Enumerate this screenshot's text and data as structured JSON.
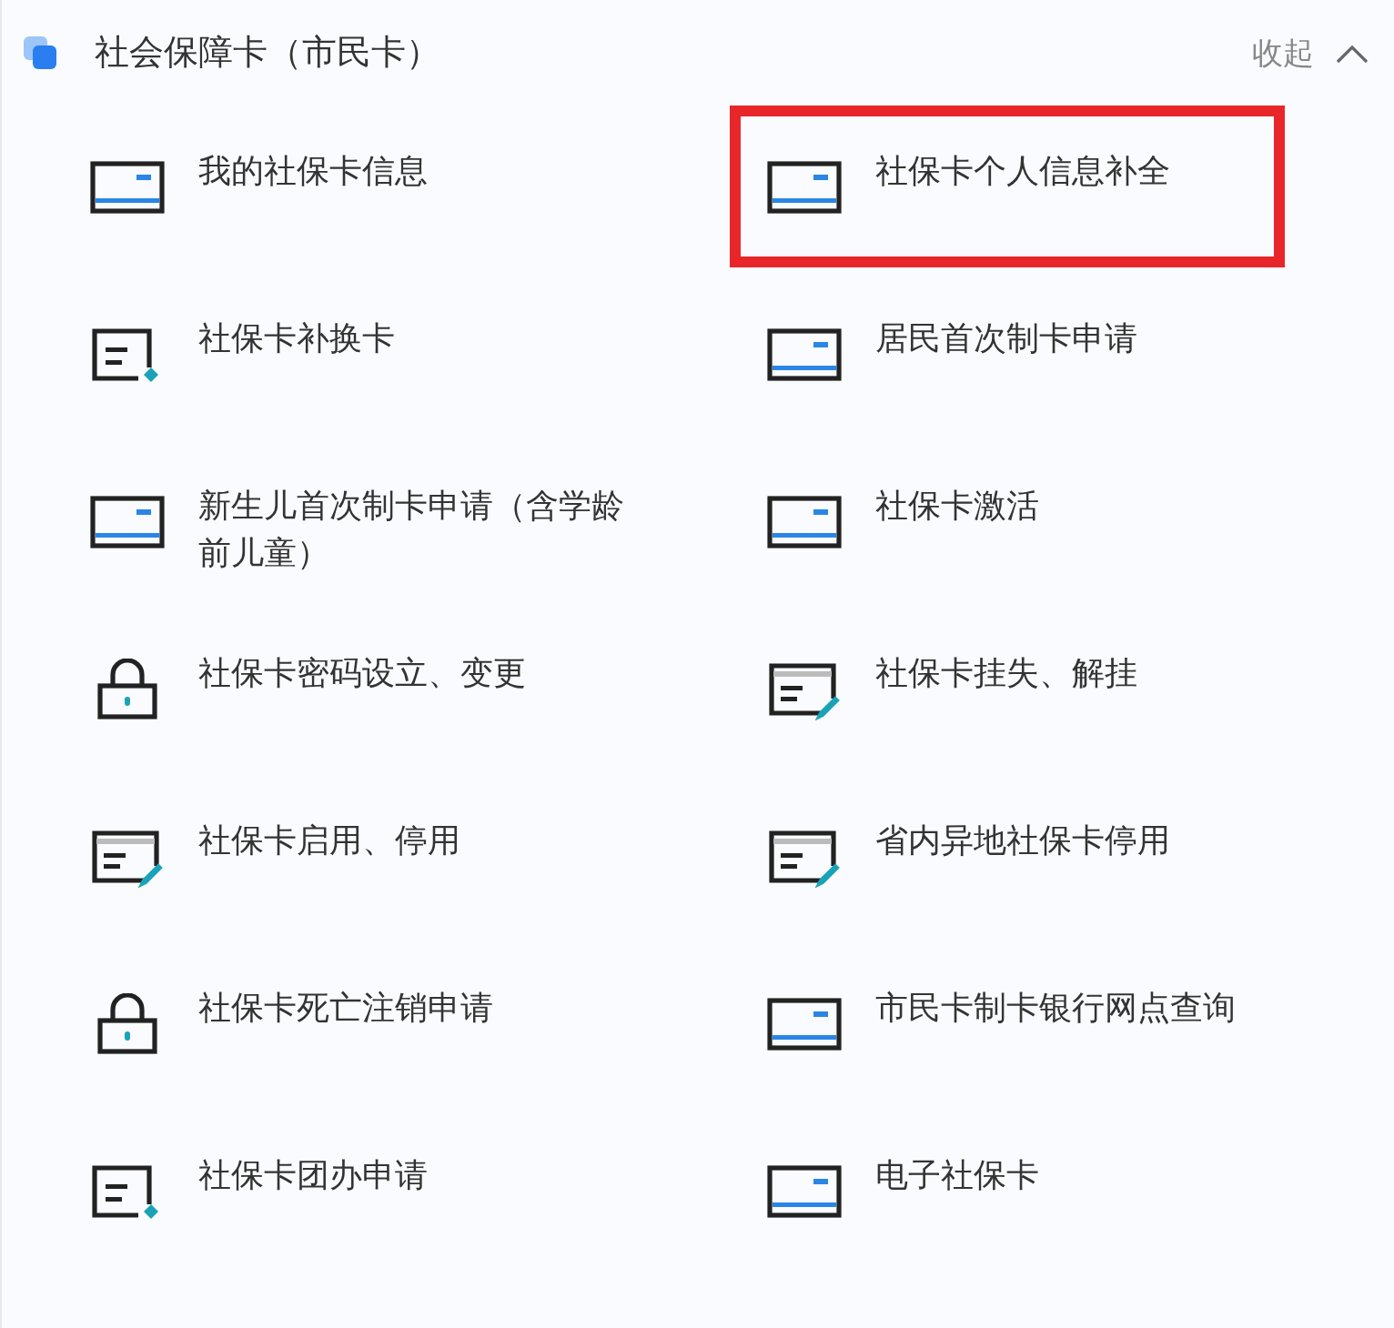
{
  "header": {
    "title": "社会保障卡（市民卡）",
    "collapse_label": "收起",
    "expanded": true
  },
  "items": [
    {
      "label": "我的社保卡信息",
      "kind": "card",
      "highlighted": false
    },
    {
      "label": "社保卡个人信息补全",
      "kind": "card",
      "highlighted": true
    },
    {
      "label": "社保卡补换卡",
      "kind": "form",
      "highlighted": false
    },
    {
      "label": "居民首次制卡申请",
      "kind": "card",
      "highlighted": false
    },
    {
      "label": "新生儿首次制卡申请（含学龄前儿童）",
      "kind": "card",
      "highlighted": false
    },
    {
      "label": "社保卡激活",
      "kind": "card",
      "highlighted": false
    },
    {
      "label": "社保卡密码设立、变更",
      "kind": "lock",
      "highlighted": false
    },
    {
      "label": "社保卡挂失、解挂",
      "kind": "edit",
      "highlighted": false
    },
    {
      "label": "社保卡启用、停用",
      "kind": "edit",
      "highlighted": false
    },
    {
      "label": "省内异地社保卡停用",
      "kind": "edit",
      "highlighted": false
    },
    {
      "label": "社保卡死亡注销申请",
      "kind": "lock",
      "highlighted": false
    },
    {
      "label": "市民卡制卡银行网点查询",
      "kind": "card",
      "highlighted": false
    },
    {
      "label": "社保卡团办申请",
      "kind": "form",
      "highlighted": false
    },
    {
      "label": "电子社保卡",
      "kind": "card",
      "highlighted": false
    }
  ]
}
